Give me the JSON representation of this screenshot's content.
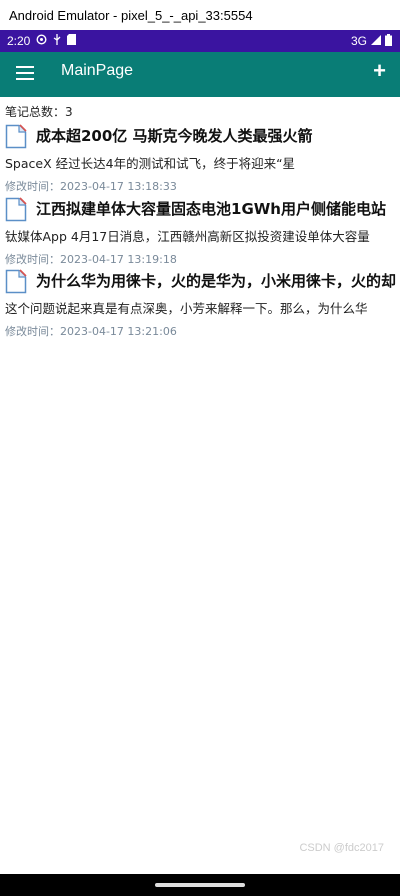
{
  "window": {
    "title": "Android Emulator - pixel_5_-_api_33:5554"
  },
  "status_bar": {
    "time": "2:20",
    "network": "3G"
  },
  "app_bar": {
    "title": "MainPage",
    "add_label": "+"
  },
  "notes_count_text": "笔记总数：3",
  "notes": [
    {
      "title": "成本超200亿 马斯克今晚发人类最强火箭",
      "body": "SpaceX 经过长达4年的测试和试飞，终于将迎来“星",
      "time": "修改时间：2023-04-17 13:18:33"
    },
    {
      "title": "江西拟建单体大容量固态电池1GWh用户侧储能电站",
      "body": "钛媒体App 4月17日消息，江西赣州高新区拟投资建设单体大容量",
      "time": "修改时间：2023-04-17 13:19:18"
    },
    {
      "title": "为什么华为用徕卡，火的是华为，小米用徕卡，火的却",
      "body": "这个问题说起来真是有点深奥，小芳来解释一下。那么，为什么华",
      "time": "修改时间：2023-04-17 13:21:06"
    }
  ],
  "watermark": "CSDN @fdc2017",
  "icons": {
    "menu": "menu-icon",
    "note": "document-icon"
  }
}
